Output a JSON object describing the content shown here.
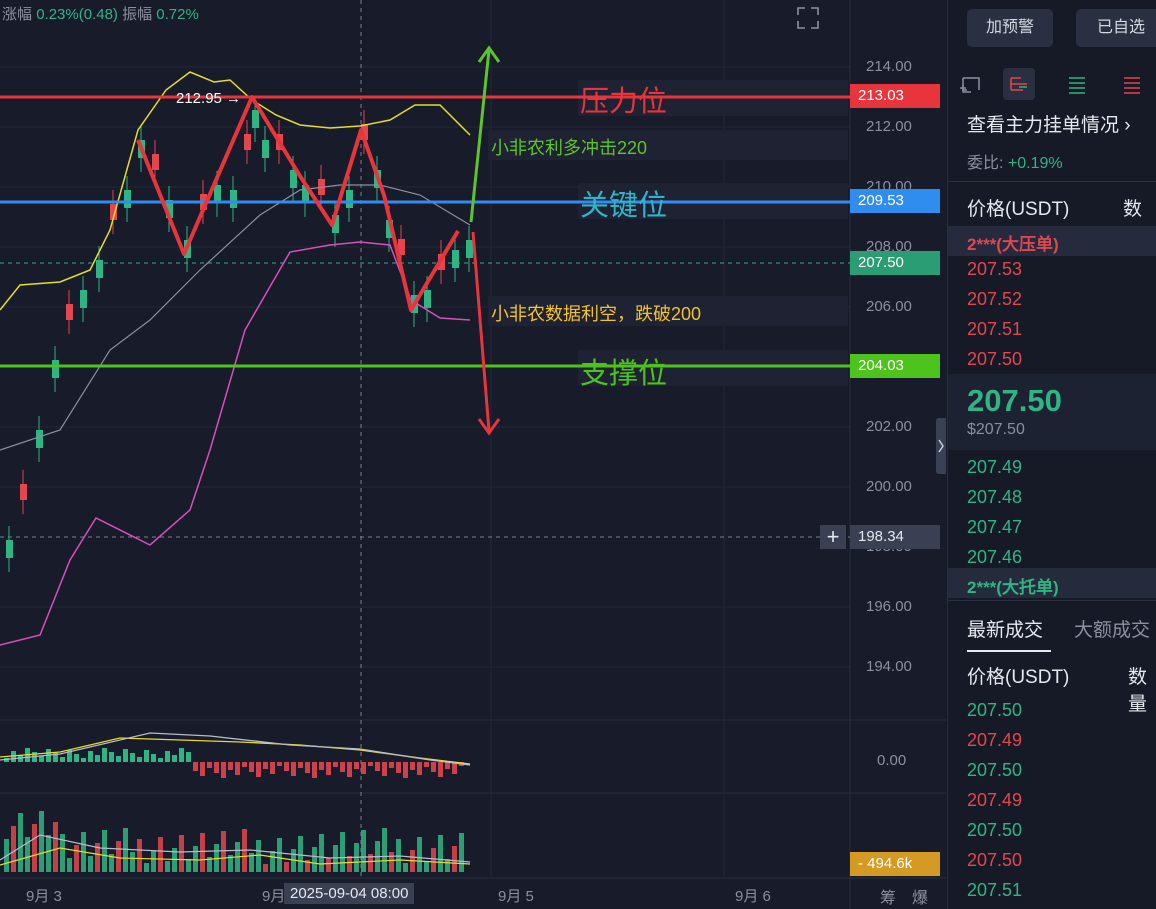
{
  "chart": {
    "stats": {
      "change_label": "涨幅",
      "change_value": "0.23%(0.48)",
      "amp_label": "振幅",
      "amp_value": "0.72%"
    },
    "price_axis": [
      "214.00",
      "212.00",
      "210.00",
      "208.00",
      "206.00",
      "202.00",
      "200.00",
      "198.00",
      "196.00",
      "194.00"
    ],
    "macd_zero": "0.00",
    "tags": {
      "resistance": "213.03",
      "key": "209.53",
      "last": "207.50",
      "support": "204.03",
      "crosshair": "198.34",
      "volume": "494.6k"
    },
    "high_marker": "212.95",
    "annotations": {
      "resistance": "压力位",
      "key": "关键位",
      "support": "支撑位",
      "bull": "小非农利多冲击220",
      "bear": "小非农数据利空，跌破200"
    },
    "x_labels": {
      "d3": "9月 3",
      "d4": "9月",
      "d5": "9月 5",
      "d6": "9月 6"
    },
    "crosshair_time": "2025-09-04 08:00",
    "bottom_right": {
      "chips": "筹",
      "burst": "爆"
    },
    "colors": {
      "up": "#2fb584",
      "down": "#e2464f",
      "resistance": "#e8343b",
      "key": "#2f8df0",
      "support": "#4cc41b",
      "bull_arrow": "#5ec42a",
      "bear_arrow": "#e8343b"
    }
  },
  "sidebar": {
    "alert_button": "加预警",
    "watch_button": "已自选",
    "orders_title": "查看主力挂单情况",
    "ratio_label": "委比:",
    "ratio_value": "+0.19%",
    "price_header": "价格(USDT)",
    "qty_header": "数量",
    "big_ask": "2***(大压单)",
    "asks": [
      "207.53",
      "207.52",
      "207.51",
      "207.50"
    ],
    "last_price": "207.50",
    "last_price_usd": "$207.50",
    "bids": [
      "207.49",
      "207.48",
      "207.47",
      "207.46"
    ],
    "big_bid": "2***(大托单)",
    "trade_tabs": [
      "最新成交",
      "大额成交"
    ],
    "trades_price_header": "价格(USDT)",
    "trades_qty_header": "数量",
    "trades": [
      {
        "price": "207.50",
        "side": "buy"
      },
      {
        "price": "207.49",
        "side": "sell"
      },
      {
        "price": "207.50",
        "side": "buy"
      },
      {
        "price": "207.49",
        "side": "sell"
      },
      {
        "price": "207.50",
        "side": "buy"
      },
      {
        "price": "207.50",
        "side": "sell"
      },
      {
        "price": "207.51",
        "side": "buy"
      }
    ]
  }
}
